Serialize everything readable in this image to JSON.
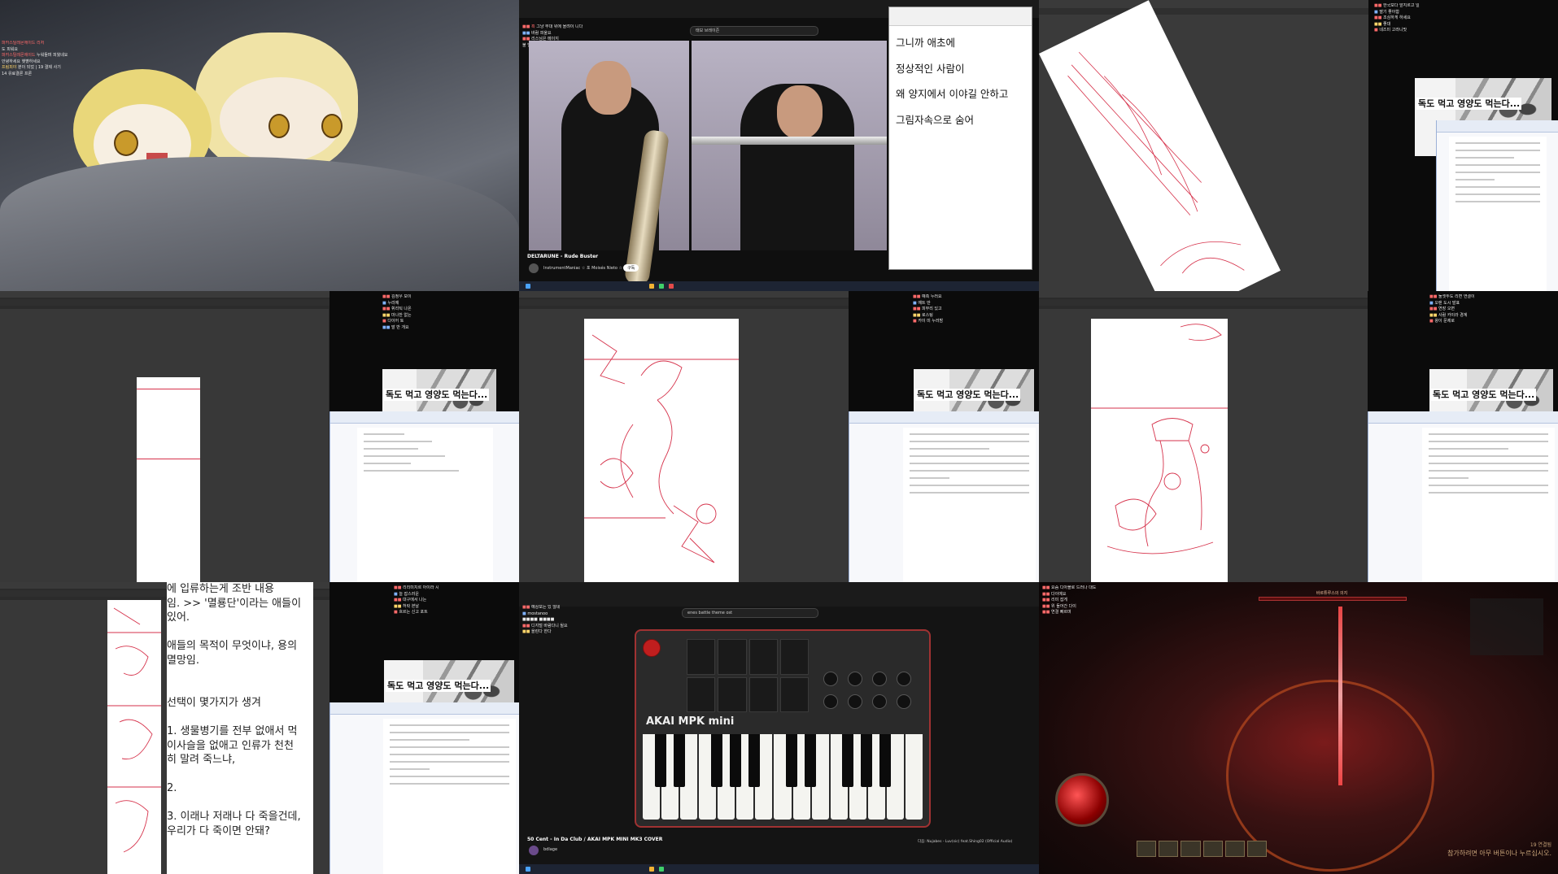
{
  "tile1": {
    "chat": [
      {
        "user": "파카스틸레몬에이드 리처",
        "msg": ""
      },
      {
        "user": "",
        "msg": "도 피워요 "
      },
      {
        "user": "파카스틸레몬에이드",
        "msg": "누워들며 피웠네요"
      },
      {
        "user": "",
        "msg": "안녕하세요 햇볕하세요"
      },
      {
        "user": "프림피야",
        "msg": "분이 되었 | 19 결제 사기"
      },
      {
        "user": "",
        "msg": "14 유료결론 프론"
      }
    ]
  },
  "tile2": {
    "video_title": "DELTARUNE - Rude Buster",
    "channel": "InstrumentManiac ☆ 포 Moisés Nieto ☆",
    "subscribe_label": "구독",
    "search_text": "태보 브레이즌",
    "notepad_lines": [
      "그니까 애초에",
      "정상적인 사람이",
      "왜 양지에서 이야길 안하고",
      "그림자속으로 숨어"
    ]
  },
  "manga_caption": "독도 먹고 영양도 먹는다...",
  "tile7": {
    "lines": [
      "에 입류하는게 조반 내용",
      "임. >> '멸룡단'이라는 애들이",
      "있어.",
      "",
      "애들의 목적이 무엇이냐, 용의",
      "멸망임.",
      "",
      "",
      "선택이 몇가지가 생겨",
      "",
      "1. 생물병기를 전부 없애서 먹",
      "이사슬을 없애고 인류가 천천",
      "히 말려 죽느냐,",
      "",
      "2.",
      "",
      "3. 이래나 저래나 다 죽을건데,",
      "우리가 다 죽이면 안돼?"
    ]
  },
  "tile8": {
    "video_title": "50 Cent - In Da Club / AKAI MPK MINI MK3 COVER",
    "channel": "bdlage",
    "search_text": "enes battle theme ost",
    "brand": "AKAI MPK mini",
    "next_up": "다음: Nujabes - Luv(sic) feat.Shing02 (Official Audio)"
  },
  "tile9": {
    "bottom_text": "참가하려면 아무 버튼이나 누르십시오.",
    "boss_name": "바르튜루스의 의지",
    "level_tag": "19 연결됨"
  },
  "colors": {
    "sketch_red": "#d6324b",
    "chat_name": "#ff6a6a",
    "akai_red": "#a03232"
  }
}
